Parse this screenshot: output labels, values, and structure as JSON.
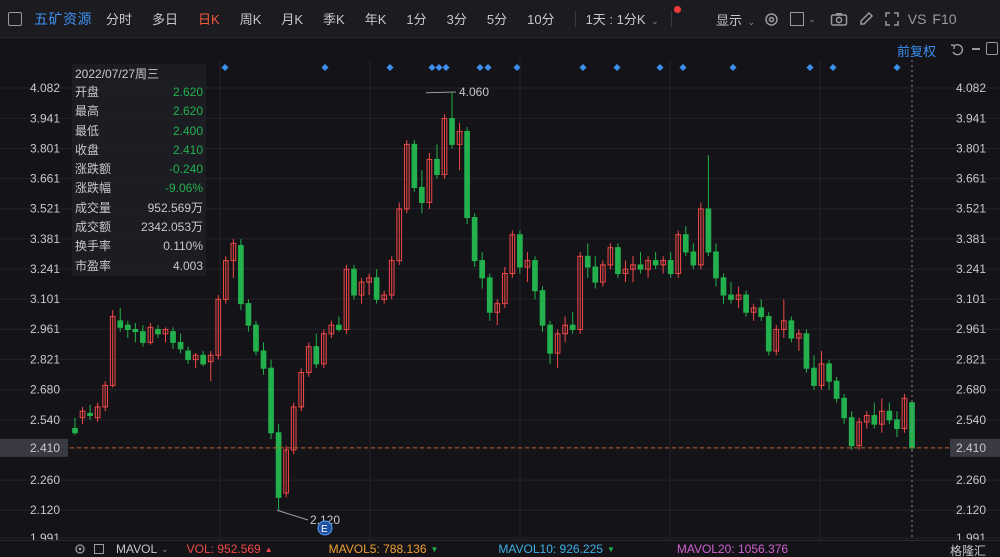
{
  "header": {
    "stock_name": "五矿资源",
    "periods": [
      {
        "label": "分时",
        "active": false
      },
      {
        "label": "多日",
        "active": false
      },
      {
        "label": "日K",
        "active": true
      },
      {
        "label": "周K",
        "active": false
      },
      {
        "label": "月K",
        "active": false
      },
      {
        "label": "季K",
        "active": false
      },
      {
        "label": "年K",
        "active": false
      },
      {
        "label": "1分",
        "active": false
      },
      {
        "label": "3分",
        "active": false
      },
      {
        "label": "5分",
        "active": false
      },
      {
        "label": "10分",
        "active": false
      }
    ],
    "more_period": "1天 : 1分K",
    "display_label": "显示",
    "vs_label": "VS",
    "f10_label": "F10",
    "adjust_label": "前复权"
  },
  "colors": {
    "up": "#f04848",
    "down": "#22b14c",
    "accent": "#3d8ff0",
    "active_tab": "#f25a3a",
    "price_line": "#c0602a"
  },
  "info_panel": {
    "date": "2022/07/27周三",
    "rows": [
      {
        "key": "开盘",
        "value": "2.620",
        "color": "down"
      },
      {
        "key": "最高",
        "value": "2.620",
        "color": "down"
      },
      {
        "key": "最低",
        "value": "2.400",
        "color": "down"
      },
      {
        "key": "收盘",
        "value": "2.410",
        "color": "down"
      },
      {
        "key": "涨跌额",
        "value": "-0.240",
        "color": "down"
      },
      {
        "key": "涨跌幅",
        "value": "-9.06%",
        "color": "down"
      },
      {
        "key": "成交量",
        "value": "952.569万",
        "color": "neutral"
      },
      {
        "key": "成交额",
        "value": "2342.053万",
        "color": "neutral"
      },
      {
        "key": "换手率",
        "value": "0.110%",
        "color": "neutral"
      },
      {
        "key": "市盈率",
        "value": "4.003",
        "color": "neutral"
      }
    ]
  },
  "axis": {
    "ticks": [
      "4.082",
      "3.941",
      "3.801",
      "3.661",
      "3.521",
      "3.381",
      "3.241",
      "3.101",
      "2.961",
      "2.821",
      "2.680",
      "2.540",
      "2.410",
      "2.260",
      "2.120",
      "1.991"
    ],
    "current_price": "2.410"
  },
  "annotations": {
    "high_label": "4.060",
    "low_label": "2.120",
    "event_marker": "E"
  },
  "indicators": {
    "mavol": "MAVOL",
    "vol": "VOL: 952.569",
    "mavol5": "MAVOL5: 788.136",
    "mavol10": "MAVOL10: 926.225",
    "mavol20": "MAVOL20: 1056.376",
    "vol_color": "#f04848",
    "mavol5_color": "#f0a030",
    "mavol10_color": "#3cb0e8",
    "mavol20_color": "#d060d0"
  },
  "watermark": "格隆汇",
  "chart_data": {
    "type": "candlestick",
    "ylim": [
      1.991,
      4.082
    ],
    "highest": 4.06,
    "lowest": 2.12,
    "last_close": 2.41,
    "candles": [
      {
        "o": 2.5,
        "h": 2.55,
        "l": 2.47,
        "c": 2.48
      },
      {
        "o": 2.55,
        "h": 2.6,
        "l": 2.52,
        "c": 2.58
      },
      {
        "o": 2.57,
        "h": 2.61,
        "l": 2.54,
        "c": 2.56
      },
      {
        "o": 2.55,
        "h": 2.62,
        "l": 2.53,
        "c": 2.6
      },
      {
        "o": 2.6,
        "h": 2.72,
        "l": 2.58,
        "c": 2.7
      },
      {
        "o": 2.7,
        "h": 3.05,
        "l": 2.69,
        "c": 3.02
      },
      {
        "o": 3.0,
        "h": 3.06,
        "l": 2.95,
        "c": 2.97
      },
      {
        "o": 2.98,
        "h": 3.0,
        "l": 2.92,
        "c": 2.96
      },
      {
        "o": 2.96,
        "h": 2.99,
        "l": 2.9,
        "c": 2.95
      },
      {
        "o": 2.95,
        "h": 2.98,
        "l": 2.88,
        "c": 2.9
      },
      {
        "o": 2.9,
        "h": 2.99,
        "l": 2.89,
        "c": 2.97
      },
      {
        "o": 2.96,
        "h": 2.98,
        "l": 2.92,
        "c": 2.94
      },
      {
        "o": 2.94,
        "h": 2.97,
        "l": 2.9,
        "c": 2.96
      },
      {
        "o": 2.95,
        "h": 2.97,
        "l": 2.87,
        "c": 2.9
      },
      {
        "o": 2.9,
        "h": 2.94,
        "l": 2.85,
        "c": 2.87
      },
      {
        "o": 2.86,
        "h": 2.88,
        "l": 2.8,
        "c": 2.82
      },
      {
        "o": 2.82,
        "h": 2.85,
        "l": 2.78,
        "c": 2.84
      },
      {
        "o": 2.84,
        "h": 2.86,
        "l": 2.79,
        "c": 2.8
      },
      {
        "o": 2.81,
        "h": 2.86,
        "l": 2.72,
        "c": 2.84
      },
      {
        "o": 2.84,
        "h": 3.12,
        "l": 2.82,
        "c": 3.1
      },
      {
        "o": 3.1,
        "h": 3.3,
        "l": 3.08,
        "c": 3.28
      },
      {
        "o": 3.28,
        "h": 3.38,
        "l": 3.2,
        "c": 3.36
      },
      {
        "o": 3.35,
        "h": 3.38,
        "l": 3.05,
        "c": 3.08
      },
      {
        "o": 3.08,
        "h": 3.1,
        "l": 2.95,
        "c": 2.98
      },
      {
        "o": 2.98,
        "h": 3.0,
        "l": 2.84,
        "c": 2.86
      },
      {
        "o": 2.86,
        "h": 2.9,
        "l": 2.75,
        "c": 2.78
      },
      {
        "o": 2.78,
        "h": 2.82,
        "l": 2.45,
        "c": 2.48
      },
      {
        "o": 2.48,
        "h": 2.52,
        "l": 2.12,
        "c": 2.18
      },
      {
        "o": 2.2,
        "h": 2.42,
        "l": 2.18,
        "c": 2.4
      },
      {
        "o": 2.4,
        "h": 2.62,
        "l": 2.38,
        "c": 2.6
      },
      {
        "o": 2.6,
        "h": 2.78,
        "l": 2.58,
        "c": 2.76
      },
      {
        "o": 2.76,
        "h": 2.9,
        "l": 2.74,
        "c": 2.88
      },
      {
        "o": 2.88,
        "h": 2.94,
        "l": 2.78,
        "c": 2.8
      },
      {
        "o": 2.8,
        "h": 2.96,
        "l": 2.78,
        "c": 2.94
      },
      {
        "o": 2.94,
        "h": 3.0,
        "l": 2.92,
        "c": 2.98
      },
      {
        "o": 2.98,
        "h": 3.02,
        "l": 2.95,
        "c": 2.96
      },
      {
        "o": 2.96,
        "h": 3.26,
        "l": 2.94,
        "c": 3.24
      },
      {
        "o": 3.24,
        "h": 3.26,
        "l": 3.1,
        "c": 3.12
      },
      {
        "o": 3.12,
        "h": 3.2,
        "l": 3.08,
        "c": 3.18
      },
      {
        "o": 3.18,
        "h": 3.22,
        "l": 3.12,
        "c": 3.2
      },
      {
        "o": 3.2,
        "h": 3.24,
        "l": 3.08,
        "c": 3.1
      },
      {
        "o": 3.1,
        "h": 3.14,
        "l": 3.08,
        "c": 3.12
      },
      {
        "o": 3.12,
        "h": 3.3,
        "l": 3.1,
        "c": 3.28
      },
      {
        "o": 3.28,
        "h": 3.55,
        "l": 3.26,
        "c": 3.52
      },
      {
        "o": 3.52,
        "h": 3.84,
        "l": 3.5,
        "c": 3.82
      },
      {
        "o": 3.82,
        "h": 3.84,
        "l": 3.6,
        "c": 3.62
      },
      {
        "o": 3.62,
        "h": 3.7,
        "l": 3.5,
        "c": 3.55
      },
      {
        "o": 3.55,
        "h": 3.78,
        "l": 3.52,
        "c": 3.75
      },
      {
        "o": 3.75,
        "h": 3.82,
        "l": 3.66,
        "c": 3.68
      },
      {
        "o": 3.68,
        "h": 3.96,
        "l": 3.66,
        "c": 3.94
      },
      {
        "o": 3.94,
        "h": 4.06,
        "l": 3.8,
        "c": 3.82
      },
      {
        "o": 3.82,
        "h": 3.92,
        "l": 3.7,
        "c": 3.88
      },
      {
        "o": 3.88,
        "h": 3.9,
        "l": 3.45,
        "c": 3.48
      },
      {
        "o": 3.48,
        "h": 3.5,
        "l": 3.25,
        "c": 3.28
      },
      {
        "o": 3.28,
        "h": 3.32,
        "l": 3.15,
        "c": 3.2
      },
      {
        "o": 3.2,
        "h": 3.22,
        "l": 3.0,
        "c": 3.04
      },
      {
        "o": 3.04,
        "h": 3.1,
        "l": 2.98,
        "c": 3.08
      },
      {
        "o": 3.08,
        "h": 3.25,
        "l": 3.06,
        "c": 3.22
      },
      {
        "o": 3.22,
        "h": 3.42,
        "l": 3.2,
        "c": 3.4
      },
      {
        "o": 3.4,
        "h": 3.42,
        "l": 3.22,
        "c": 3.25
      },
      {
        "o": 3.25,
        "h": 3.32,
        "l": 3.18,
        "c": 3.28
      },
      {
        "o": 3.28,
        "h": 3.3,
        "l": 3.1,
        "c": 3.14
      },
      {
        "o": 3.14,
        "h": 3.16,
        "l": 2.95,
        "c": 2.98
      },
      {
        "o": 2.98,
        "h": 3.0,
        "l": 2.8,
        "c": 2.85
      },
      {
        "o": 2.85,
        "h": 2.96,
        "l": 2.78,
        "c": 2.94
      },
      {
        "o": 2.94,
        "h": 3.02,
        "l": 2.9,
        "c": 2.98
      },
      {
        "o": 2.98,
        "h": 3.04,
        "l": 2.94,
        "c": 2.96
      },
      {
        "o": 2.96,
        "h": 3.32,
        "l": 2.94,
        "c": 3.3
      },
      {
        "o": 3.3,
        "h": 3.36,
        "l": 3.2,
        "c": 3.25
      },
      {
        "o": 3.25,
        "h": 3.3,
        "l": 3.15,
        "c": 3.18
      },
      {
        "o": 3.18,
        "h": 3.28,
        "l": 3.16,
        "c": 3.26
      },
      {
        "o": 3.26,
        "h": 3.36,
        "l": 3.24,
        "c": 3.34
      },
      {
        "o": 3.34,
        "h": 3.36,
        "l": 3.2,
        "c": 3.22
      },
      {
        "o": 3.22,
        "h": 3.28,
        "l": 3.18,
        "c": 3.24
      },
      {
        "o": 3.24,
        "h": 3.3,
        "l": 3.18,
        "c": 3.26
      },
      {
        "o": 3.26,
        "h": 3.32,
        "l": 3.22,
        "c": 3.24
      },
      {
        "o": 3.24,
        "h": 3.3,
        "l": 3.2,
        "c": 3.28
      },
      {
        "o": 3.28,
        "h": 3.32,
        "l": 3.24,
        "c": 3.26
      },
      {
        "o": 3.26,
        "h": 3.3,
        "l": 3.22,
        "c": 3.28
      },
      {
        "o": 3.28,
        "h": 3.32,
        "l": 3.2,
        "c": 3.22
      },
      {
        "o": 3.22,
        "h": 3.42,
        "l": 3.2,
        "c": 3.4
      },
      {
        "o": 3.4,
        "h": 3.44,
        "l": 3.3,
        "c": 3.32
      },
      {
        "o": 3.32,
        "h": 3.36,
        "l": 3.24,
        "c": 3.26
      },
      {
        "o": 3.26,
        "h": 3.55,
        "l": 3.24,
        "c": 3.52
      },
      {
        "o": 3.52,
        "h": 3.77,
        "l": 3.3,
        "c": 3.32
      },
      {
        "o": 3.32,
        "h": 3.36,
        "l": 3.16,
        "c": 3.2
      },
      {
        "o": 3.2,
        "h": 3.22,
        "l": 3.08,
        "c": 3.12
      },
      {
        "o": 3.12,
        "h": 3.18,
        "l": 3.08,
        "c": 3.1
      },
      {
        "o": 3.1,
        "h": 3.16,
        "l": 3.06,
        "c": 3.12
      },
      {
        "o": 3.12,
        "h": 3.14,
        "l": 3.02,
        "c": 3.04
      },
      {
        "o": 3.04,
        "h": 3.08,
        "l": 3.0,
        "c": 3.06
      },
      {
        "o": 3.06,
        "h": 3.1,
        "l": 3.0,
        "c": 3.02
      },
      {
        "o": 3.02,
        "h": 3.04,
        "l": 2.84,
        "c": 2.86
      },
      {
        "o": 2.86,
        "h": 2.98,
        "l": 2.84,
        "c": 2.96
      },
      {
        "o": 2.96,
        "h": 3.1,
        "l": 2.92,
        "c": 3.0
      },
      {
        "o": 3.0,
        "h": 3.02,
        "l": 2.9,
        "c": 2.92
      },
      {
        "o": 2.92,
        "h": 2.96,
        "l": 2.86,
        "c": 2.94
      },
      {
        "o": 2.94,
        "h": 2.96,
        "l": 2.76,
        "c": 2.78
      },
      {
        "o": 2.78,
        "h": 2.84,
        "l": 2.68,
        "c": 2.7
      },
      {
        "o": 2.7,
        "h": 2.86,
        "l": 2.68,
        "c": 2.8
      },
      {
        "o": 2.8,
        "h": 2.82,
        "l": 2.68,
        "c": 2.72
      },
      {
        "o": 2.72,
        "h": 2.74,
        "l": 2.62,
        "c": 2.64
      },
      {
        "o": 2.64,
        "h": 2.66,
        "l": 2.52,
        "c": 2.55
      },
      {
        "o": 2.55,
        "h": 2.58,
        "l": 2.4,
        "c": 2.42
      },
      {
        "o": 2.42,
        "h": 2.55,
        "l": 2.4,
        "c": 2.53
      },
      {
        "o": 2.53,
        "h": 2.58,
        "l": 2.5,
        "c": 2.56
      },
      {
        "o": 2.56,
        "h": 2.62,
        "l": 2.5,
        "c": 2.52
      },
      {
        "o": 2.52,
        "h": 2.64,
        "l": 2.48,
        "c": 2.58
      },
      {
        "o": 2.58,
        "h": 2.62,
        "l": 2.52,
        "c": 2.54
      },
      {
        "o": 2.54,
        "h": 2.58,
        "l": 2.46,
        "c": 2.5
      },
      {
        "o": 2.5,
        "h": 2.66,
        "l": 2.48,
        "c": 2.64
      },
      {
        "o": 2.62,
        "h": 2.62,
        "l": 2.4,
        "c": 2.41
      }
    ],
    "markers_count": 16
  }
}
